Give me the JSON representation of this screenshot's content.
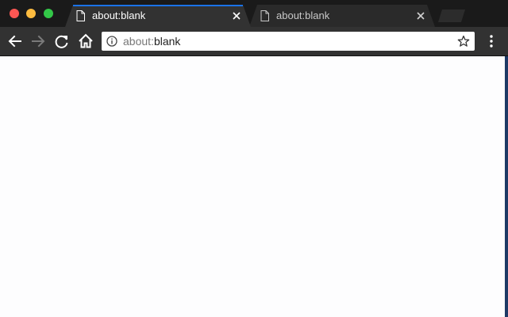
{
  "window": {
    "controls": [
      "close",
      "minimize",
      "maximize"
    ]
  },
  "tabs": [
    {
      "title": "about:blank",
      "active": true,
      "icon": "document-icon"
    },
    {
      "title": "about:blank",
      "active": false,
      "icon": "document-icon"
    }
  ],
  "toolbar": {
    "back_icon": "arrow-left-icon",
    "forward_icon": "arrow-right-icon",
    "reload_icon": "reload-icon",
    "home_icon": "home-icon",
    "menu_icon": "kebab-menu-icon"
  },
  "omnibox": {
    "url_scheme": "about:",
    "url_rest": "blank",
    "info_icon": "info-icon",
    "bookmark_icon": "star-icon"
  },
  "colors": {
    "active_tab_accent": "#1a73e8",
    "page_background": "#fdfdfe",
    "chrome_dark": "#323232"
  }
}
